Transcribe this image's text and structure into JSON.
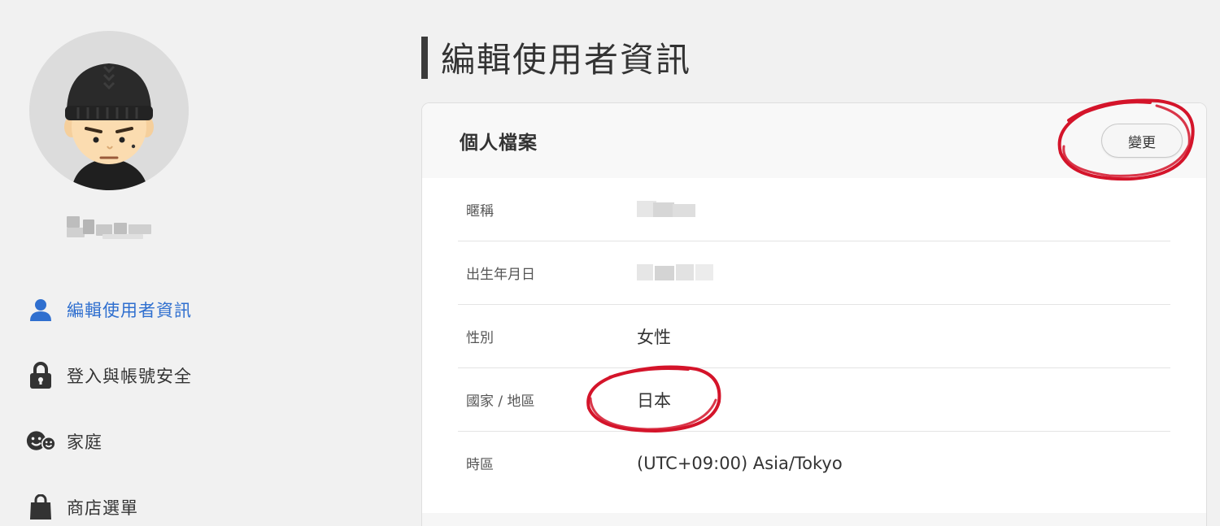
{
  "sidebar": {
    "nav": [
      {
        "label": "編輯使用者資訊",
        "icon": "user-icon",
        "active": true
      },
      {
        "label": "登入與帳號安全",
        "icon": "lock-icon",
        "active": false
      },
      {
        "label": "家庭",
        "icon": "family-icon",
        "active": false
      },
      {
        "label": "商店選單",
        "icon": "shopping-bag-icon",
        "active": false
      }
    ]
  },
  "main": {
    "title": "編輯使用者資訊",
    "profile": {
      "title": "個人檔案",
      "change_label": "變更",
      "fields": [
        {
          "label": "暱稱",
          "value": null
        },
        {
          "label": "出生年月日",
          "value": null
        },
        {
          "label": "性別",
          "value": "女性"
        },
        {
          "label": "國家 / 地區",
          "value": "日本"
        },
        {
          "label": "時區",
          "value": "(UTC+09:00) Asia/Tokyo"
        }
      ]
    }
  },
  "colors": {
    "accent": "#2f6fcf",
    "annotation": "#d4142a",
    "background": "#f1f1f1"
  }
}
